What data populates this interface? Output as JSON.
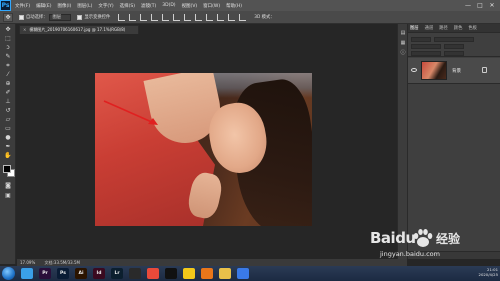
{
  "app": {
    "logo": "Ps",
    "menu": [
      "文件(F)",
      "编辑(E)",
      "图像(I)",
      "图层(L)",
      "文字(Y)",
      "选择(S)",
      "滤镜(T)",
      "3D(D)",
      "视图(V)",
      "窗口(W)",
      "帮助(H)"
    ],
    "window_controls": [
      "—",
      "□",
      "✕"
    ]
  },
  "options": {
    "auto_select_label": "自动选择：",
    "auto_select_value": "图层",
    "transform_label": "显示变换控件",
    "mode_3d": "3D 模式："
  },
  "document": {
    "tab_title": "模糊图片_20190706160617.jpg @ 17.1%(RGB/8)",
    "close": "×"
  },
  "status": {
    "zoom": "17.09%",
    "doc_size": "文档:33.5M/33.5M"
  },
  "layers_panel": {
    "tabs": [
      "图层",
      "通道",
      "路径",
      "颜色",
      "色板"
    ],
    "active_tab": "图层",
    "layers": [
      {
        "name": "背景",
        "visible": true,
        "locked": true
      }
    ]
  },
  "taskbar": {
    "apps": [
      {
        "label": "",
        "name": "ie",
        "color": "#3aa0e8"
      },
      {
        "label": "Pr",
        "name": "premiere",
        "color": "#2a0f3a"
      },
      {
        "label": "Ps",
        "name": "photoshop",
        "color": "#0a1c35"
      },
      {
        "label": "Ai",
        "name": "illustrator",
        "color": "#2b1400"
      },
      {
        "label": "Id",
        "name": "indesign",
        "color": "#3a0a20"
      },
      {
        "label": "Lr",
        "name": "lightroom",
        "color": "#0c1f2e"
      },
      {
        "label": "",
        "name": "media",
        "color": "#2a2a2a"
      },
      {
        "label": "",
        "name": "app-globe",
        "color": "#e84a3a"
      },
      {
        "label": "",
        "name": "qq",
        "color": "#111"
      },
      {
        "label": "",
        "name": "chrome",
        "color": "#f2c81a"
      },
      {
        "label": "",
        "name": "firefox",
        "color": "#e8761a"
      },
      {
        "label": "",
        "name": "explorer",
        "color": "#e8c04a"
      },
      {
        "label": "",
        "name": "app-blue",
        "color": "#3a7ae8"
      }
    ],
    "clock_time": "21:01",
    "clock_date": "2020/4/25"
  },
  "watermark": {
    "logo": "Baidu",
    "cn": "经验",
    "url": "jingyan.baidu.com"
  }
}
